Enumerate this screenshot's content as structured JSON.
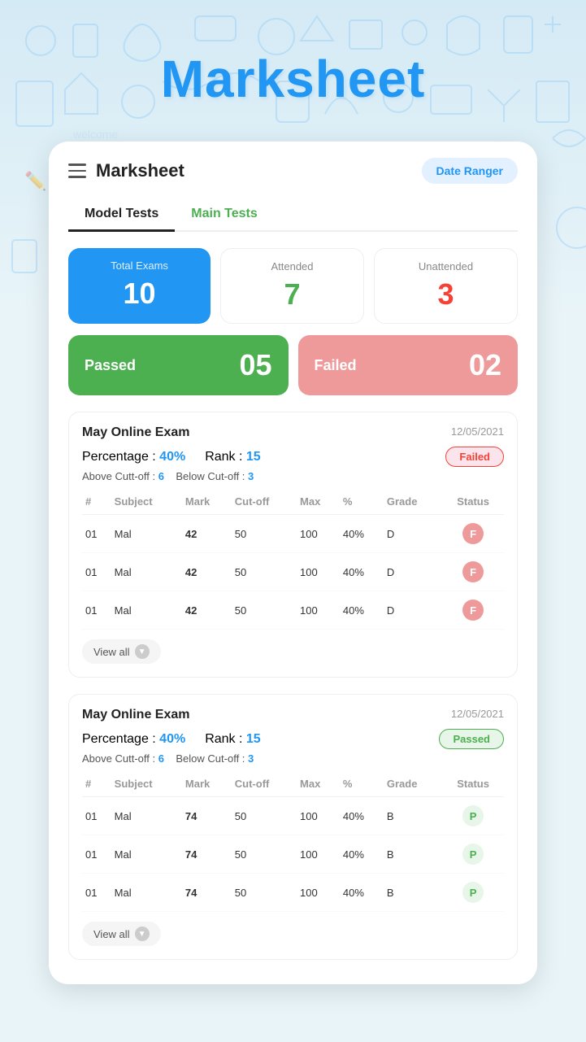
{
  "app": {
    "title": "Marksheet",
    "card_title": "Marksheet",
    "date_ranger_btn": "Date Ranger",
    "tabs": [
      {
        "label": "Model Tests",
        "active": true
      },
      {
        "label": "Main Tests",
        "active": false
      }
    ]
  },
  "stats": {
    "total_exams_label": "Total Exams",
    "total_exams_value": "10",
    "attended_label": "Attended",
    "attended_value": "7",
    "unattended_label": "Unattended",
    "unattended_value": "3",
    "passed_label": "Passed",
    "passed_value": "05",
    "failed_label": "Failed",
    "failed_value": "02"
  },
  "exams": [
    {
      "id": "exam1",
      "name": "May Online Exam",
      "date": "12/05/2021",
      "percentage": "40%",
      "rank": "15",
      "above_cutoff": "6",
      "below_cutoff": "3",
      "status": "Failed",
      "status_type": "failed",
      "subjects": [
        {
          "num": "01",
          "subject": "Mal",
          "mark": "42",
          "cutoff": "50",
          "max": "100",
          "percent": "40%",
          "grade": "D",
          "status": "F"
        },
        {
          "num": "01",
          "subject": "Mal",
          "mark": "42",
          "cutoff": "50",
          "max": "100",
          "percent": "40%",
          "grade": "D",
          "status": "F"
        },
        {
          "num": "01",
          "subject": "Mal",
          "mark": "42",
          "cutoff": "50",
          "max": "100",
          "percent": "40%",
          "grade": "D",
          "status": "F"
        }
      ],
      "view_all_label": "View all"
    },
    {
      "id": "exam2",
      "name": "May Online Exam",
      "date": "12/05/2021",
      "percentage": "40%",
      "rank": "15",
      "above_cutoff": "6",
      "below_cutoff": "3",
      "status": "Passed",
      "status_type": "passed",
      "subjects": [
        {
          "num": "01",
          "subject": "Mal",
          "mark": "74",
          "cutoff": "50",
          "max": "100",
          "percent": "40%",
          "grade": "B",
          "status": "P"
        },
        {
          "num": "01",
          "subject": "Mal",
          "mark": "74",
          "cutoff": "50",
          "max": "100",
          "percent": "40%",
          "grade": "B",
          "status": "P"
        },
        {
          "num": "01",
          "subject": "Mal",
          "mark": "74",
          "cutoff": "50",
          "max": "100",
          "percent": "40%",
          "grade": "B",
          "status": "P"
        }
      ],
      "view_all_label": "View all"
    }
  ],
  "table_headers": {
    "num": "#",
    "subject": "Subject",
    "mark": "Mark",
    "cutoff": "Cut-off",
    "max": "Max",
    "percent": "%",
    "grade": "Grade",
    "status": "Status"
  },
  "meta_labels": {
    "percentage": "Percentage : ",
    "rank": "Rank : ",
    "above_cutoff": "Above Cutt-off : ",
    "below_cutoff": "Below Cut-off : "
  }
}
